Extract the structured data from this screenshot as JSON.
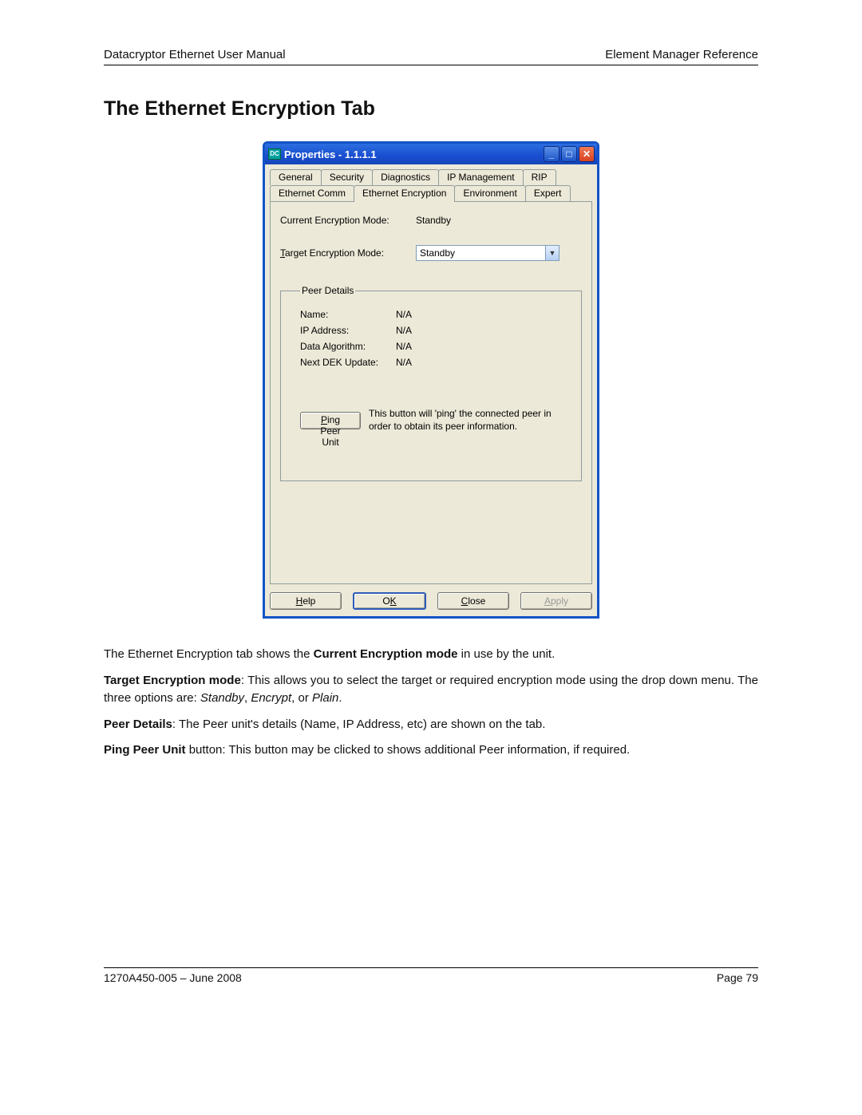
{
  "header": {
    "left": "Datacryptor Ethernet User Manual",
    "right": "Element Manager Reference"
  },
  "section_title": "The Ethernet Encryption Tab",
  "window": {
    "title": "Properties - 1.1.1.1",
    "tabs_row1": [
      "General",
      "Security",
      "Diagnostics",
      "IP Management",
      "RIP"
    ],
    "tabs_row2": [
      "Ethernet Comm",
      "Ethernet Encryption",
      "Environment",
      "Expert"
    ],
    "active_tab": "Ethernet Encryption",
    "current_mode_label": "Current Encryption Mode:",
    "current_mode_value": "Standby",
    "target_mode_label": "Target Encryption Mode:",
    "target_mode_value": "Standby",
    "peer_legend": "Peer Details",
    "peer_rows": [
      {
        "label": "Name:",
        "value": "N/A"
      },
      {
        "label": "IP Address:",
        "value": "N/A"
      },
      {
        "label": "Data Algorithm:",
        "value": "N/A"
      },
      {
        "label": "Next DEK Update:",
        "value": "N/A"
      }
    ],
    "ping_button": "Ping Peer Unit",
    "ping_text": "This button will 'ping' the connected peer in order to obtain its peer information.",
    "buttons": {
      "help": "Help",
      "ok": "OK",
      "close": "Close",
      "apply": "Apply"
    }
  },
  "paragraphs": {
    "p1a": "The Ethernet Encryption tab shows the ",
    "p1b": "Current Encryption mode",
    "p1c": " in use by the unit.",
    "p2a": "Target Encryption mode",
    "p2b": ": This allows you to select the target or required encryption mode using the drop down menu. The three options are: ",
    "p2c": "Standby",
    "p2d": ", ",
    "p2e": "Encrypt",
    "p2f": ", or ",
    "p2g": "Plain",
    "p2h": ".",
    "p3a": "Peer Details",
    "p3b": ": The Peer unit's details (Name, IP Address, etc) are shown on the tab.",
    "p4a": "Ping Peer Unit",
    "p4b": " button: This button may be clicked to shows additional Peer information, if required."
  },
  "footer": {
    "left": "1270A450-005 – June 2008",
    "right": "Page 79"
  }
}
